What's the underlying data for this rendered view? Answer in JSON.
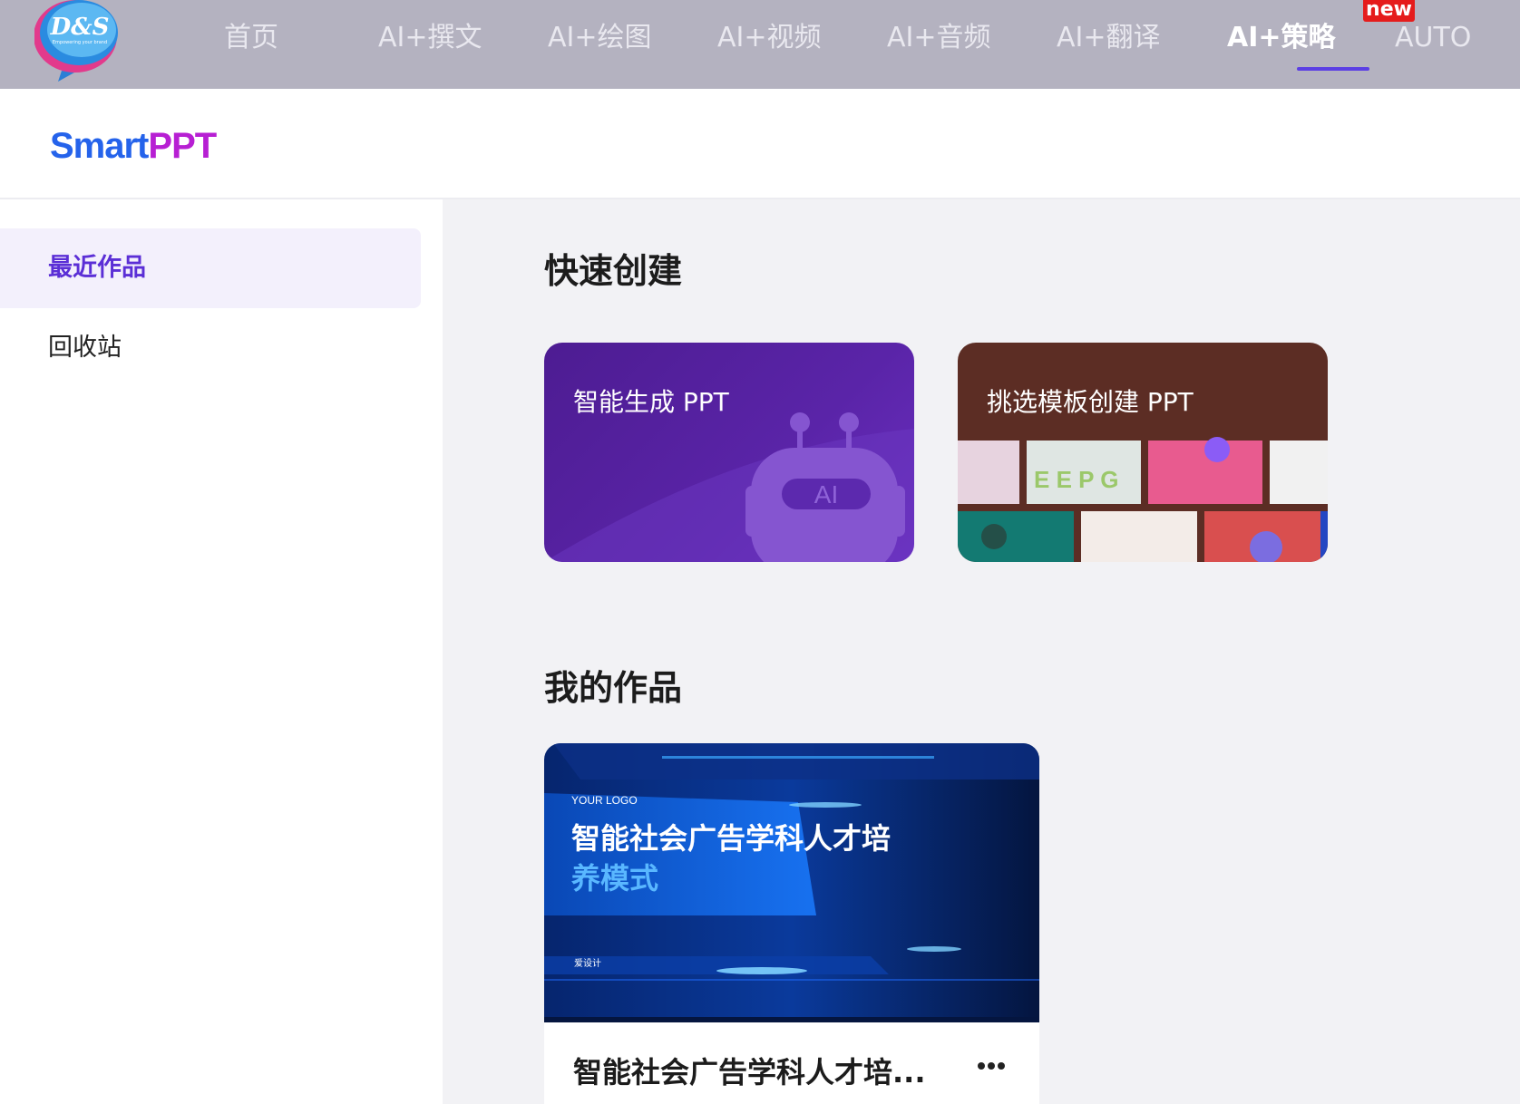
{
  "topnav": {
    "logo_text": "D&S",
    "logo_tagline": "Empowering your brand",
    "items": [
      {
        "label": "首页"
      },
      {
        "label": "AI+撰文"
      },
      {
        "label": "AI+绘图"
      },
      {
        "label": "AI+视频"
      },
      {
        "label": "AI+音频"
      },
      {
        "label": "AI+翻译"
      },
      {
        "label": "AI+策略",
        "active": true
      },
      {
        "label": "AUTO"
      }
    ],
    "new_badge": "new"
  },
  "brand": {
    "part1": "Smart",
    "part2": "PPT"
  },
  "sidebar": {
    "items": [
      {
        "label": "最近作品",
        "active": true
      },
      {
        "label": "回收站"
      }
    ]
  },
  "quick_create": {
    "title": "快速创建",
    "cards": [
      {
        "label": "智能生成 PPT",
        "badge": "AI"
      },
      {
        "label": "挑选模板创建 PPT"
      }
    ]
  },
  "my_works": {
    "title": "我的作品",
    "items": [
      {
        "name": "智能社会广告学科人才培...",
        "thumb_logo": "YOUR LOGO",
        "thumb_title_line1": "智能社会广告学科人才培",
        "thumb_title_line2": "养模式",
        "thumb_author": "爱设计"
      }
    ]
  },
  "colors": {
    "accent": "#5b2fd6",
    "nav_bg": "#b4b2c0",
    "badge_red": "#e51c1c",
    "card_purple": "#4d1c92",
    "card_brown": "#5c2d24"
  }
}
